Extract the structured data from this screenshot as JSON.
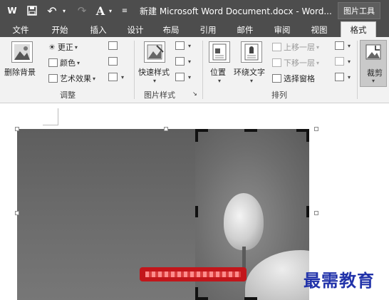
{
  "titlebar": {
    "word_icon": "W",
    "undo_icon": "↶",
    "redo_icon": "↷",
    "title": "新建 Microsoft Word Document.docx - Word...",
    "context_tools": "图片工具"
  },
  "tabs": [
    "文件",
    "开始",
    "插入",
    "设计",
    "布局",
    "引用",
    "邮件",
    "审阅",
    "视图",
    "格式"
  ],
  "active_tab": "格式",
  "ribbon": {
    "adjust": {
      "remove_bg": "删除背景",
      "correct": "更正",
      "color": "颜色",
      "artistic": "艺术效果",
      "label": "调整"
    },
    "styles": {
      "quick_styles": "快速样式",
      "label": "图片样式"
    },
    "arrange": {
      "position": "位置",
      "wrap_text": "环绕文字",
      "bring_forward": "上移一层",
      "send_backward": "下移一层",
      "selection_pane": "选择窗格",
      "label": "排列"
    },
    "size": {
      "crop": "裁剪"
    }
  },
  "watermark": "最需教育",
  "colors": {
    "title_bg": "#4d4d4d",
    "ribbon_bg": "#f2f2f2",
    "banner_red": "#c2161b",
    "watermark_blue": "#2233aa"
  }
}
